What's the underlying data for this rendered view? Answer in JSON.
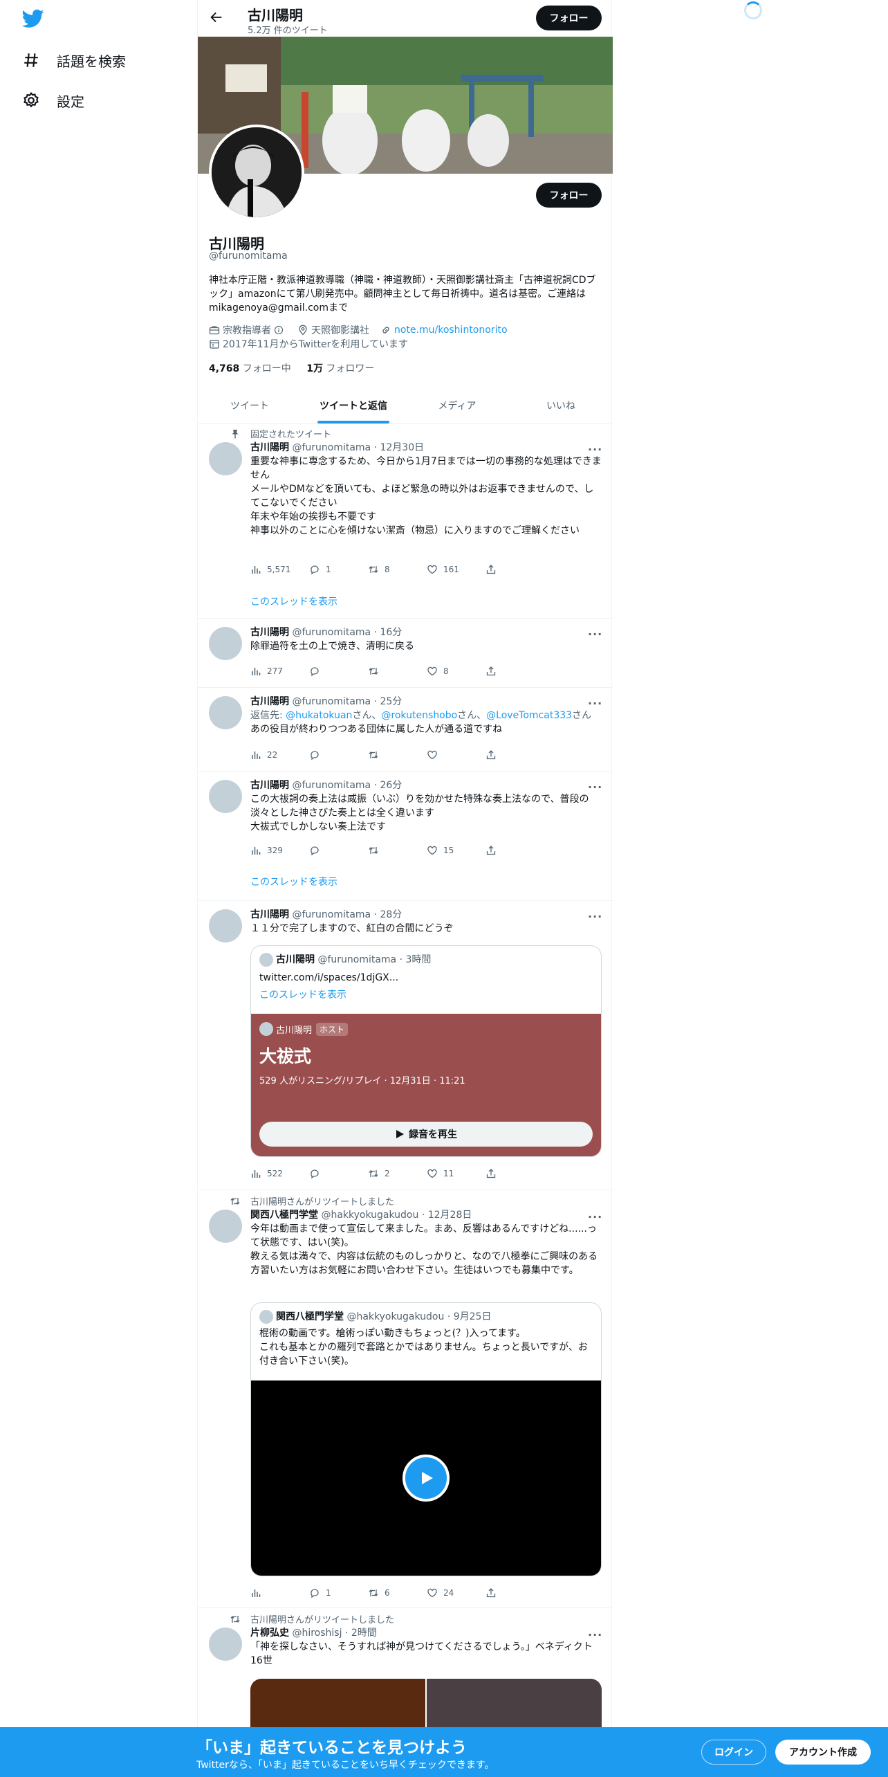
{
  "nav": {
    "explore_label": "話題を検索",
    "settings_label": "設定"
  },
  "topbar": {
    "name": "古川陽明",
    "tweet_count": "5.2万 件のツイート",
    "follow_label": "フォロー"
  },
  "profile": {
    "name": "古川陽明",
    "handle": "@furunomitama",
    "bio": "神社本庁正階・教派神道教導職（神職・神道教師）・天照御影講社斎主「古神道祝詞CDブック」amazonにて第八刷発売中。顧問神主として毎日祈祷中。道名は基密。ご連絡はmikagenoya@gmail.comまで",
    "category": "宗教指導者",
    "location": "天照御影講社",
    "url": "note.mu/koshintonorito",
    "joined": "2017年11月からTwitterを利用しています",
    "following_count": "4,768",
    "following_label": "フォロー中",
    "followers_count": "1万",
    "followers_label": "フォロワー",
    "follow_label": "フォロー"
  },
  "tabs": [
    "ツイート",
    "ツイートと返信",
    "メディア",
    "いいね"
  ],
  "tweets": [
    {
      "context": "固定されたツイート",
      "name": "古川陽明",
      "handle": "@furunomitama",
      "time": "· 12月30日",
      "text": "重要な神事に専念するため、今日から1月7日までは一切の事務的な処理はできません\nメールやDMなどを頂いても、よほど緊急の時以外はお返事できませんので、してこないでください\n年末や年始の挨拶も不要です\n神事以外のことに心を傾けない潔斎（物忌）に入りますのでご理解ください",
      "views": "5,571",
      "replies": "1",
      "retweets": "8",
      "likes": "161",
      "thread": "このスレッドを表示"
    },
    {
      "name": "古川陽明",
      "handle": "@furunomitama",
      "time": "· 16分",
      "text": "除罪過符を土の上で焼き、清明に戻る",
      "views": "277",
      "replies": "",
      "retweets": "",
      "likes": "8"
    },
    {
      "name": "古川陽明",
      "handle": "@furunomitama",
      "time": "· 25分",
      "reply_prefix": "返信先: ",
      "reply_to": [
        "@hukatokuan",
        "@rokutenshobo",
        "@LoveTomcat333"
      ],
      "reply_san": "さん",
      "reply_sep": "、",
      "text": "あの役目が終わりつつある団体に属した人が通る道ですね",
      "views": "22",
      "replies": "",
      "retweets": "",
      "likes": ""
    },
    {
      "name": "古川陽明",
      "handle": "@furunomitama",
      "time": "· 26分",
      "text": "この大祓詞の奏上法は威振（いぶ）りを効かせた特殊な奏上法なので、普段の淡々とした神さびた奏上とは全く違います\n大祓式でしかしない奏上法です",
      "views": "329",
      "replies": "",
      "retweets": "",
      "likes": "15",
      "thread": "このスレッドを表示"
    },
    {
      "name": "古川陽明",
      "handle": "@furunomitama",
      "time": "· 28分",
      "text": "１１分で完了しますので、紅白の合間にどうぞ",
      "quote": {
        "name": "古川陽明",
        "handle": "@furunomitama",
        "time": "· 3時間",
        "text": "twitter.com/i/spaces/1djGX...",
        "thread": "このスレッドを表示",
        "space_host_name": "古川陽明",
        "space_host_badge": "ホスト",
        "space_title": "大祓式",
        "space_stats": "529 人がリスニング/リプレイ · 12月31日 · 11:21",
        "space_button": "録音を再生"
      },
      "views": "522",
      "replies": "",
      "retweets": "2",
      "likes": "11"
    },
    {
      "context": "古川陽明さんがリツイートしました",
      "name": "関西八極門学堂",
      "handle": "@hakkyokugakudou",
      "time": "· 12月28日",
      "text": "今年は動画まで使って宣伝して来ました。まあ、反響はあるんですけどね......って状態です、はい(笑)。\n教える気は満々で、内容は伝統のものしっかりと、なので八極拳にご興味のある方習いたい方はお気軽にお問い合わせ下さい。生徒はいつでも募集中です。",
      "quote": {
        "name": "関西八極門学堂",
        "handle": "@hakkyokugakudou",
        "time": "· 9月25日",
        "text": "棍術の動画です。槍術っぽい動きもちょっと(？)入ってます。\nこれも基本とかの羅列で套路とかではありません。ちょっと長いですが、お付き合い下さい(笑)。"
      },
      "views": "",
      "replies": "1",
      "retweets": "6",
      "likes": "24"
    },
    {
      "context": "古川陽明さんがリツイートしました",
      "name": "片柳弘史",
      "handle": "@hiroshisj",
      "time": "· 2時間",
      "text": "「神を探しなさい、そうすれば神が見つけてくださるでしょう。」ベネディクト16世"
    }
  ],
  "bottombar": {
    "title": "「いま」起きていることを見つけよう",
    "subtitle": "Twitterなら、「いま」起きていることをいち早くチェックできます。",
    "login": "ログイン",
    "signup": "アカウント作成"
  },
  "colors": {
    "accent": "#1d9bf0",
    "text": "#0f1419",
    "muted": "#536471",
    "space": "#9a4e4e"
  }
}
